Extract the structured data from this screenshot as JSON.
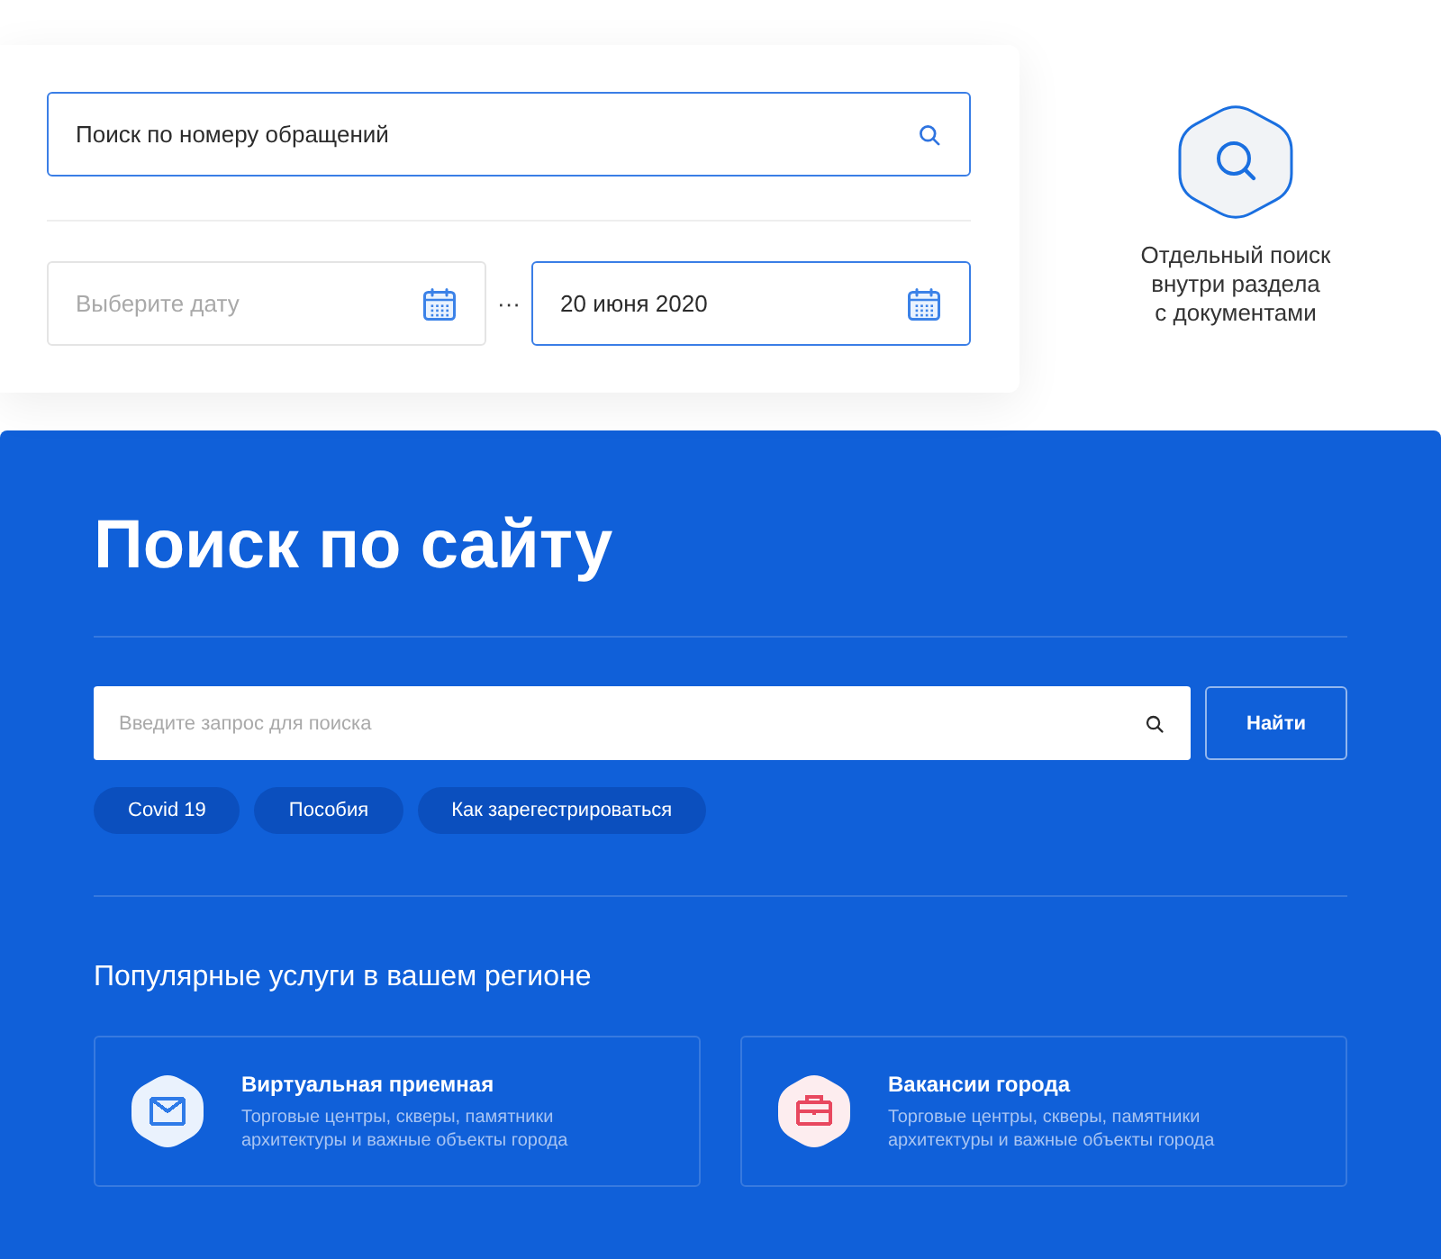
{
  "record_search": {
    "search": {
      "value": "Поиск по номеру обращений"
    },
    "date_range": {
      "from": {
        "placeholder": "Выберите дату"
      },
      "separator": "···",
      "to": {
        "value": "20 июня 2020"
      }
    }
  },
  "feature_note": {
    "caption": "Отдельный поиск внутри раздела с документами"
  },
  "site_search": {
    "title": "Поиск по сайту",
    "search": {
      "placeholder": "Введите запрос для поиска"
    },
    "button": "Найти",
    "chips": [
      "Covid 19",
      "Пособия",
      "Как зарегестрироваться"
    ],
    "popular": {
      "heading": "Популярные услуги в вашем регионе",
      "services": [
        {
          "title": "Виртуальная приемная",
          "description": "Торговые центры, скверы, памятники архитектуры и важные объекты города",
          "color": "#2f7be8"
        },
        {
          "title": "Вакансии города",
          "description": "Торговые центры, скверы, памятники архитектуры и важные объекты города",
          "color": "#e8485f"
        }
      ]
    }
  }
}
